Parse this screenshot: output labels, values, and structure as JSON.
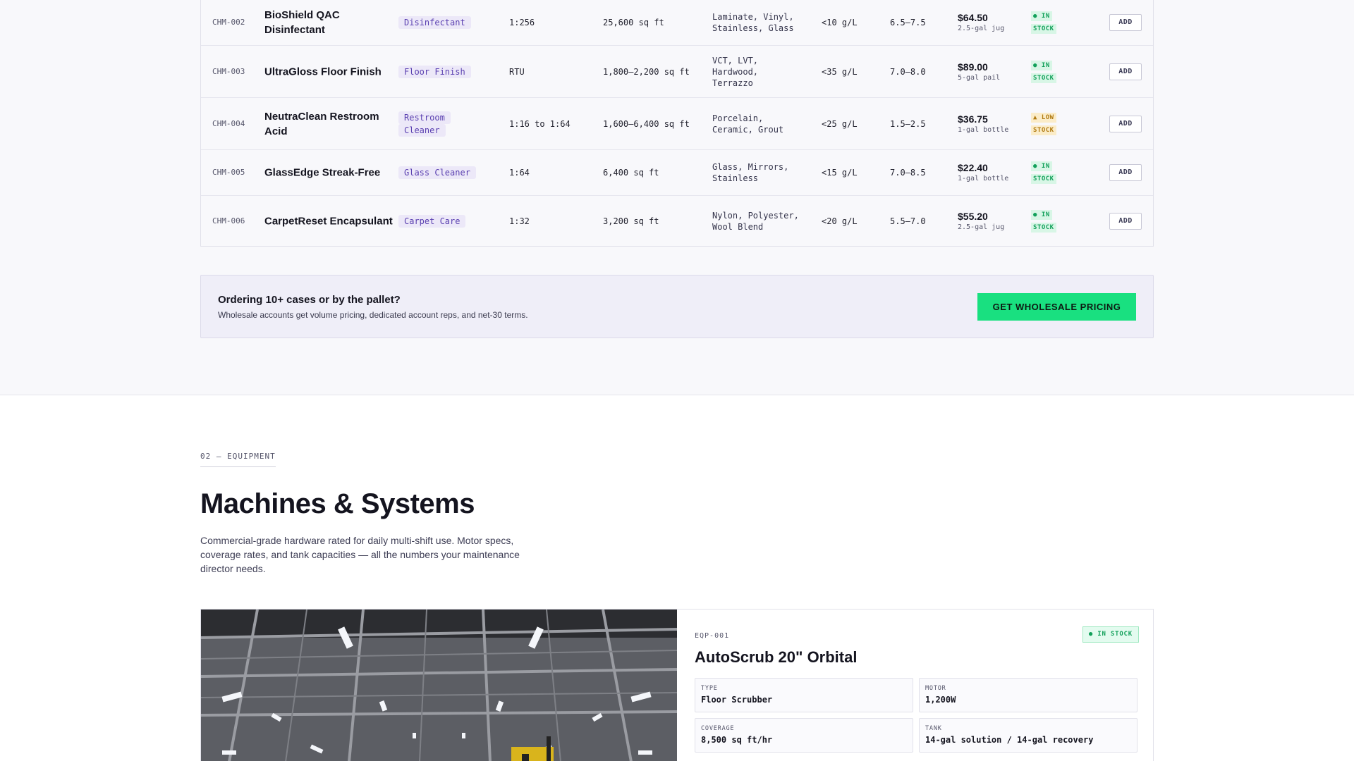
{
  "products": [
    {
      "sku": "CHM-002",
      "name": "BioShield QAC Disinfectant",
      "category": "Disinfectant",
      "dilution": "1:256",
      "coverage": "25,600 sq ft",
      "surfaces": "Laminate, Vinyl, Stainless, Glass",
      "voc": "<10 g/L",
      "ph": "6.5–7.5",
      "price": "$64.50",
      "unit": "2.5-gal jug",
      "stock": "● IN STOCK",
      "stock_type": "in",
      "add_label": "ADD"
    },
    {
      "sku": "CHM-003",
      "name": "UltraGloss Floor Finish",
      "category": "Floor Finish",
      "dilution": "RTU",
      "coverage": "1,800–2,200 sq ft",
      "surfaces": "VCT, LVT, Hardwood, Terrazzo",
      "voc": "<35 g/L",
      "ph": "7.0–8.0",
      "price": "$89.00",
      "unit": "5-gal pail",
      "stock": "● IN STOCK",
      "stock_type": "in",
      "add_label": "ADD"
    },
    {
      "sku": "CHM-004",
      "name": "NeutraClean Restroom Acid",
      "category": "Restroom Cleaner",
      "dilution": "1:16 to 1:64",
      "coverage": "1,600–6,400 sq ft",
      "surfaces": "Porcelain, Ceramic, Grout",
      "voc": "<25 g/L",
      "ph": "1.5–2.5",
      "price": "$36.75",
      "unit": "1-gal bottle",
      "stock": "▲ LOW STOCK",
      "stock_type": "low",
      "add_label": "ADD"
    },
    {
      "sku": "CHM-005",
      "name": "GlassEdge Streak-Free",
      "category": "Glass Cleaner",
      "dilution": "1:64",
      "coverage": "6,400 sq ft",
      "surfaces": "Glass, Mirrors, Stainless",
      "voc": "<15 g/L",
      "ph": "7.0–8.5",
      "price": "$22.40",
      "unit": "1-gal bottle",
      "stock": "● IN STOCK",
      "stock_type": "in",
      "add_label": "ADD"
    },
    {
      "sku": "CHM-006",
      "name": "CarpetReset Encapsulant",
      "category": "Carpet Care",
      "dilution": "1:32",
      "coverage": "3,200 sq ft",
      "surfaces": "Nylon, Polyester, Wool Blend",
      "voc": "<20 g/L",
      "ph": "5.5–7.0",
      "price": "$55.20",
      "unit": "2.5-gal jug",
      "stock": "● IN STOCK",
      "stock_type": "in",
      "add_label": "ADD"
    }
  ],
  "wholesale": {
    "title": "Ordering 10+ cases or by the pallet?",
    "subtitle": "Wholesale accounts get volume pricing, dedicated account reps, and net-30 terms.",
    "button": "GET WHOLESALE PRICING"
  },
  "equipment": {
    "eyebrow": "02 — EQUIPMENT",
    "title": "Machines & Systems",
    "description": "Commercial-grade hardware rated for daily multi-shift use. Motor specs, coverage rates, and tank capacities — all the numbers your maintenance director needs.",
    "card": {
      "sku": "EQP-001",
      "badge": "● IN STOCK",
      "title": "AutoScrub 20\" Orbital",
      "specs": [
        {
          "label": "TYPE",
          "value": "Floor Scrubber"
        },
        {
          "label": "MOTOR",
          "value": "1,200W"
        },
        {
          "label": "COVERAGE",
          "value": "8,500 sq ft/hr"
        },
        {
          "label": "TANK",
          "value": "14-gal solution / 14-gal recovery"
        }
      ]
    }
  },
  "colors": {
    "accent_green": "#19e080",
    "tag_purple": "#5a3fb0",
    "stock_in": "#12a05a",
    "stock_low": "#b07a10"
  }
}
